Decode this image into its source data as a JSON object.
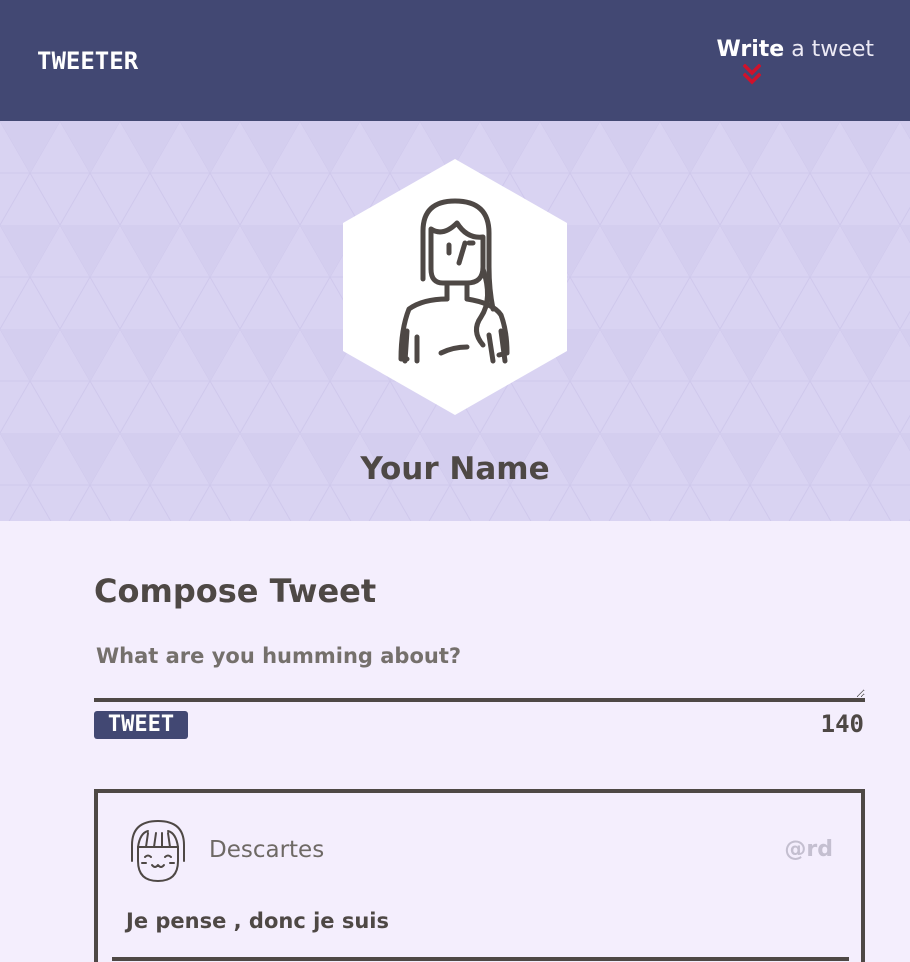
{
  "nav": {
    "brand": "TWEETER",
    "compose_strong": "Write",
    "compose_rest": " a tweet",
    "chevron_icon": "double-chevron-down-icon",
    "chevron_color": "#d0112b"
  },
  "header": {
    "user_name": "Your Name",
    "avatar_icon": "woman-avatar-icon"
  },
  "compose": {
    "title": "Compose Tweet",
    "placeholder": "What are you humming about?",
    "value": "",
    "button_label": "TWEET",
    "counter": "140"
  },
  "tweets": [
    {
      "avatar_icon": "smiling-girl-avatar-icon",
      "author": "Descartes",
      "handle": "@rd",
      "content": "Je pense , donc je suis"
    }
  ],
  "colors": {
    "nav_bg": "#424873",
    "header_bg": "#d9d3f2",
    "page_bg": "#f4eefd",
    "text": "#4e4845",
    "accent_red": "#d0112b"
  }
}
